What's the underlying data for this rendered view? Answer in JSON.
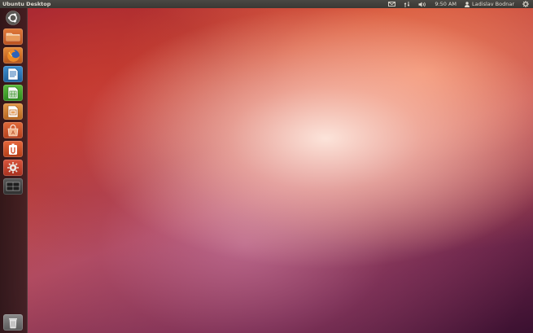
{
  "panel": {
    "title": "Ubuntu Desktop",
    "clock": "9:50 AM",
    "user": "Ladislav Bodnar",
    "icons": [
      "mail-icon",
      "network-icon",
      "volume-icon",
      "user-icon",
      "power-gear-icon"
    ]
  },
  "launcher": {
    "items": [
      {
        "name": "dash-home",
        "icon": "ubuntu-logo-icon"
      },
      {
        "name": "home-folder",
        "icon": "folder-icon"
      },
      {
        "name": "firefox",
        "icon": "firefox-icon"
      },
      {
        "name": "libreoffice-writer",
        "icon": "writer-icon"
      },
      {
        "name": "libreoffice-calc",
        "icon": "calc-icon"
      },
      {
        "name": "libreoffice-impress",
        "icon": "impress-icon"
      },
      {
        "name": "software-center",
        "icon": "shopping-bag-icon"
      },
      {
        "name": "ubuntu-one",
        "icon": "ubuntu-one-icon"
      },
      {
        "name": "system-settings",
        "icon": "settings-icon"
      },
      {
        "name": "workspace-switcher",
        "icon": "workspace-icon"
      },
      {
        "name": "trash",
        "icon": "trash-icon"
      }
    ]
  },
  "colors": {
    "panel_bg": "#3c3b37",
    "panel_text": "#dfdbd2",
    "accent": "#dd4814"
  }
}
